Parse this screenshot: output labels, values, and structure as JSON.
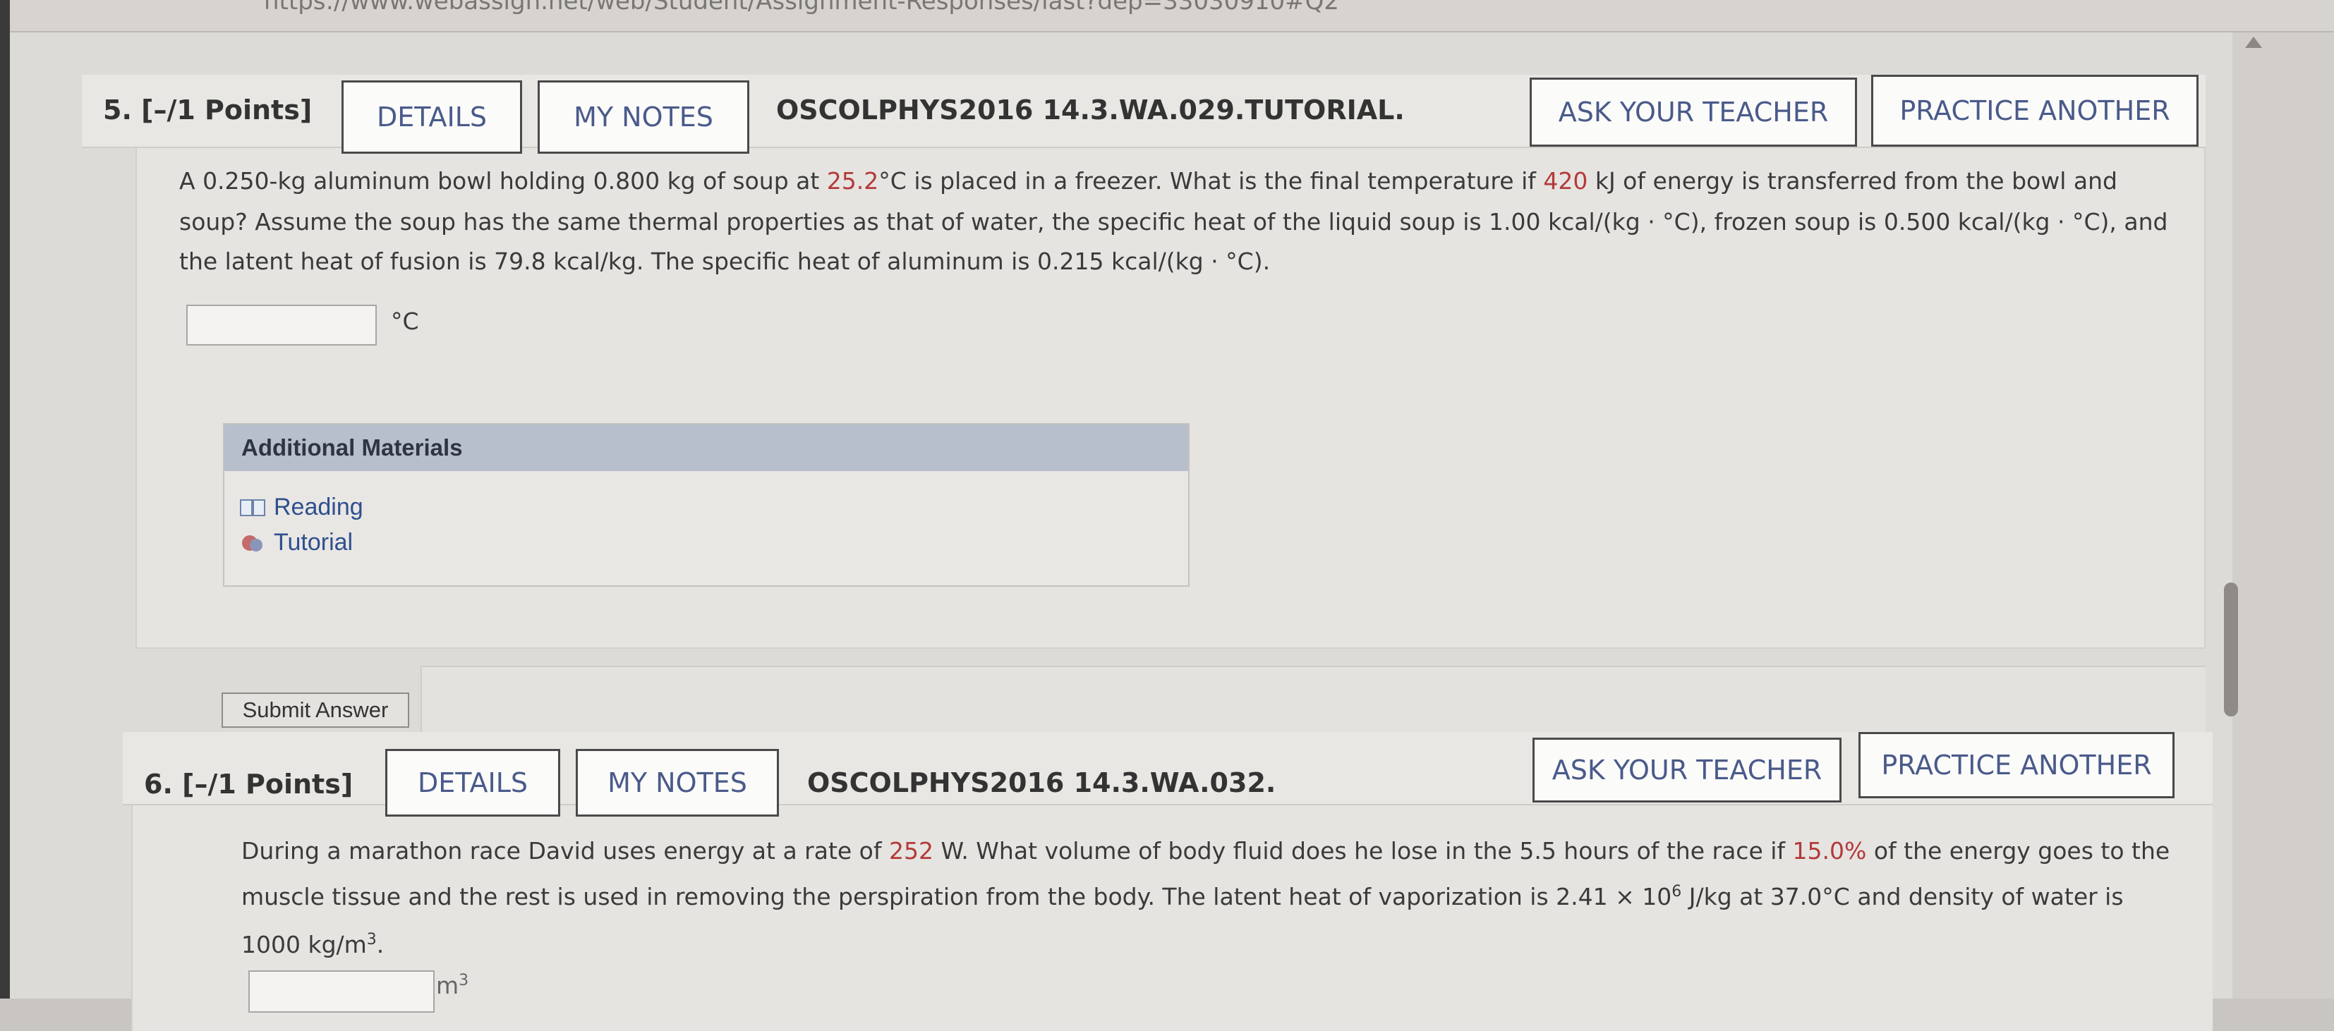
{
  "browser": {
    "url_text": "https://www.webassign.net/web/Student/Assignment-Responses/last?dep=33030910#Q2"
  },
  "question5": {
    "number_points": "5.  [–/1 Points]",
    "details_label": "DETAILS",
    "notes_label": "MY NOTES",
    "code": "OSCOLPHYS2016 14.3.WA.029.TUTORIAL.",
    "ask_label": "ASK YOUR TEACHER",
    "practice_label": "PRACTICE ANOTHER",
    "text": {
      "l1a": "A 0.250-kg aluminum bowl holding 0.800 kg of soup at ",
      "l1b": "25.2",
      "l1c": "°C is placed in a freezer. What is the final temperature if ",
      "l1d": "420",
      "l1e": " kJ of energy is transferred from the bowl and",
      "l2": "soup? Assume the soup has the same thermal properties as that of water, the specific heat of the liquid soup is 1.00 kcal/(kg · °C), frozen soup is 0.500 kcal/(kg · °C), and",
      "l3": "the latent heat of fusion is 79.8 kcal/kg. The specific heat of aluminum is 0.215 kcal/(kg · °C)."
    },
    "answer_unit": "°C",
    "additional_title": "Additional Materials",
    "materials": [
      "Reading",
      "Tutorial"
    ],
    "submit_label": "Submit Answer"
  },
  "question6": {
    "number_points": "6.  [–/1 Points]",
    "details_label": "DETAILS",
    "notes_label": "MY NOTES",
    "code": "OSCOLPHYS2016 14.3.WA.032.",
    "ask_label": "ASK YOUR TEACHER",
    "practice_label": "PRACTICE ANOTHER",
    "text": {
      "l1a": "During a marathon race David uses energy at a rate of ",
      "l1b": "252",
      "l1c": " W. What volume of body fluid does he lose in the 5.5 hours of the race if ",
      "l1d": "15.0%",
      "l1e": " of the energy goes to the",
      "l2a": "muscle tissue and the rest is used in removing the perspiration from the body. The latent heat of vaporization is 2.41 × 10",
      "l2sup": "6",
      "l2b": " J/kg at 37.0°C and density of water is",
      "l3a": "1000 kg/m",
      "l3sup": "3",
      "l3b": "."
    },
    "answer_unit": "m",
    "answer_unit_sup": "3"
  },
  "colors": {
    "highlight": "#b33a3a",
    "link": "#4a5a8a",
    "materials_header": "#b7bfcd"
  }
}
